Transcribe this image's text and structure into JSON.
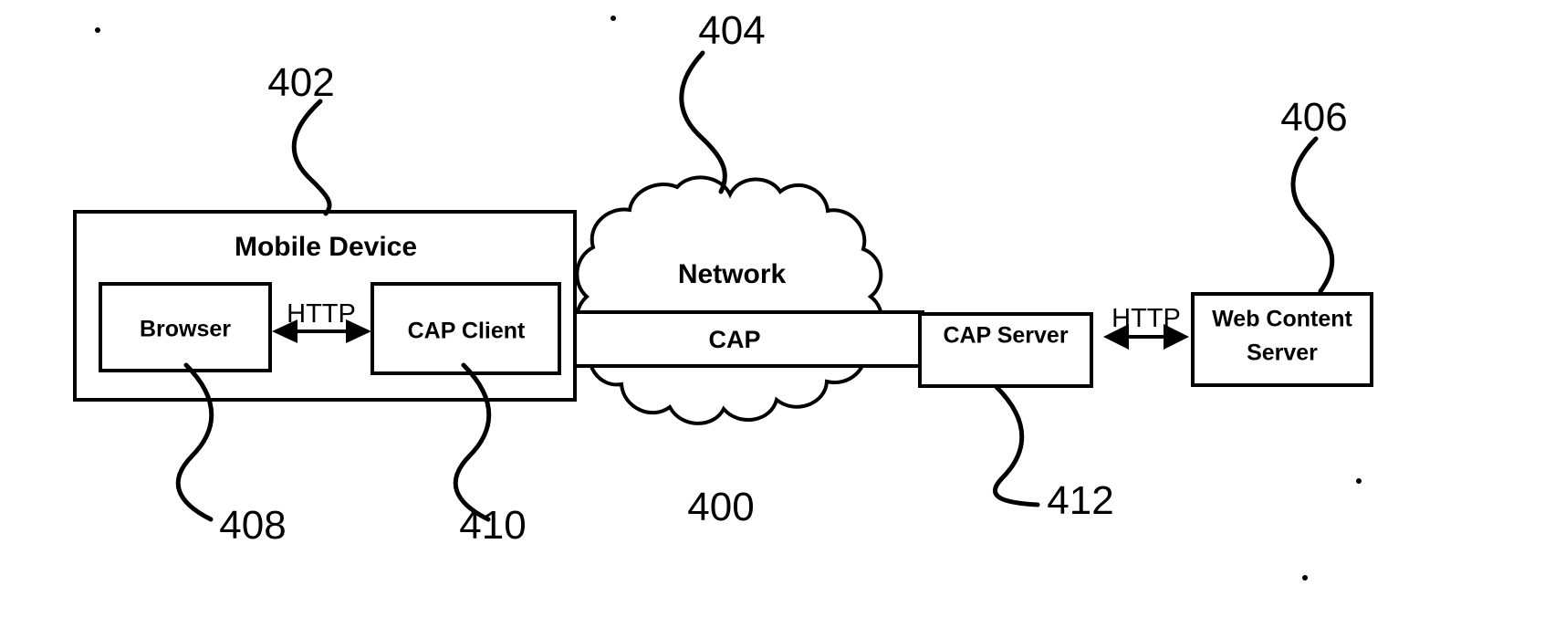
{
  "figure": {
    "type": "patent-block-diagram",
    "background": "#ffffff",
    "ink": "#000000"
  },
  "nodes": {
    "mobile_device": {
      "label": "Mobile Device",
      "ref": "402"
    },
    "browser": {
      "label": "Browser",
      "ref": "408"
    },
    "cap_client": {
      "label": "CAP Client",
      "ref": "410"
    },
    "network": {
      "label": "Network",
      "ref": "404"
    },
    "cap_pipe": {
      "label": "CAP",
      "ref": "400"
    },
    "cap_server": {
      "label": "CAP Server",
      "ref": "412"
    },
    "web_content_server": {
      "label_line1": "Web Content",
      "label_line2": "Server",
      "ref": "406"
    }
  },
  "links": {
    "browser_to_cap_client": {
      "label": "HTTP"
    },
    "cap_server_to_web_content": {
      "label": "HTTP"
    }
  },
  "reference_numbers": {
    "n400": "400",
    "n402": "402",
    "n404": "404",
    "n406": "406",
    "n408": "408",
    "n410": "410",
    "n412": "412"
  }
}
